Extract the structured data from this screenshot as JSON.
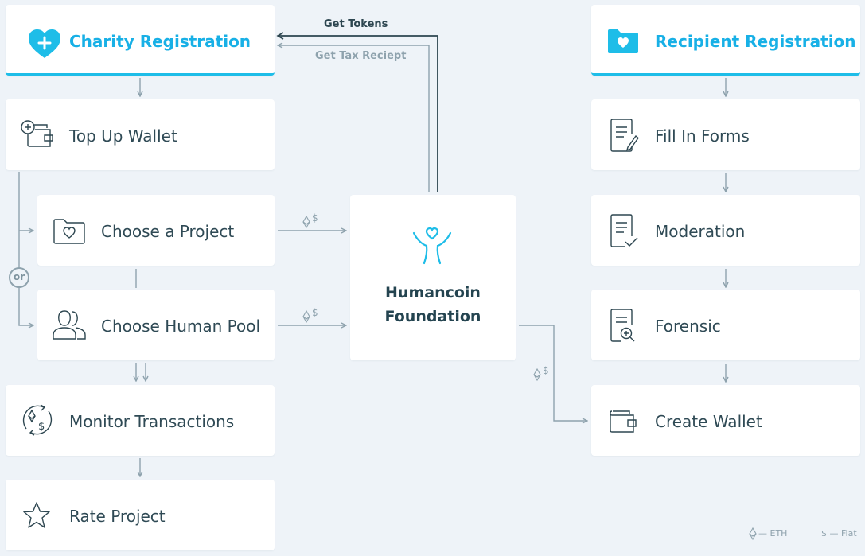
{
  "charity": {
    "header": "Charity Registration",
    "steps": {
      "top_up": "Top Up Wallet",
      "project": "Choose a Project",
      "pool": "Choose Human Pool",
      "monitor": "Monitor Transactions",
      "rate": "Rate Project"
    },
    "or_label": "or"
  },
  "foundation": {
    "name_line1": "Humancoin",
    "name_line2": "Foundation"
  },
  "flows": {
    "get_tokens": "Get Tokens",
    "get_tax_receipt": "Get Tax Reciept",
    "currency_marker": "$"
  },
  "recipient": {
    "header": "Recipient Registration",
    "steps": {
      "forms": "Fill In Forms",
      "moderation": "Moderation",
      "forensic": "Forensic",
      "wallet": "Create Wallet"
    }
  },
  "legend": {
    "eth": "— ETH",
    "fiat": "$ — Fiat"
  },
  "colors": {
    "accent": "#1ebde8",
    "line_dark": "#2d4650",
    "line_light": "#8ea2ad",
    "background": "#eef3f8"
  }
}
